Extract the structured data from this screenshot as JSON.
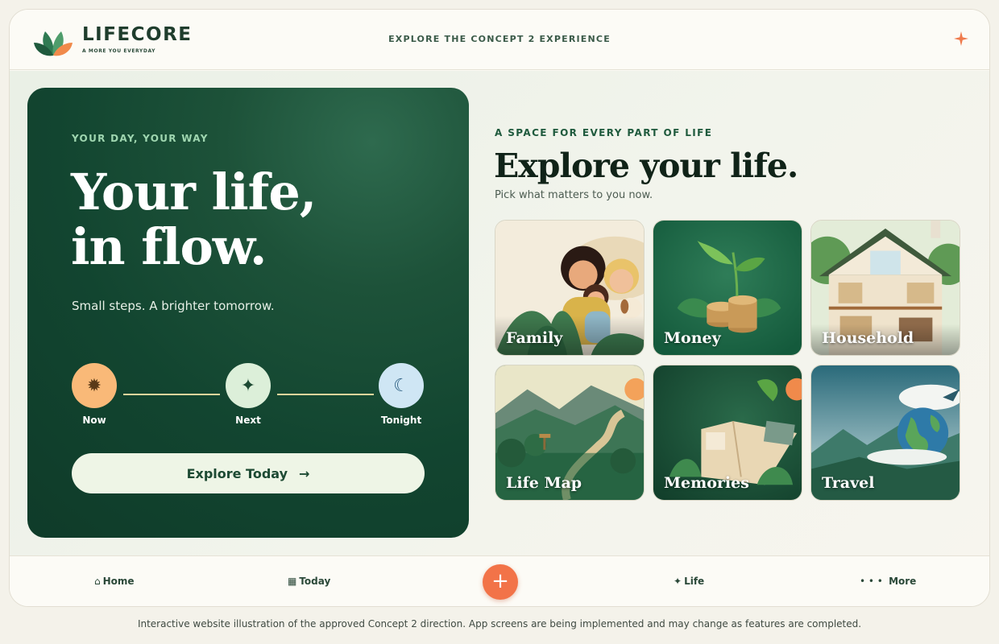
{
  "header": {
    "brand_name": "LIFECORE",
    "brand_tagline": "A MORE YOU EVERYDAY",
    "center_link": "EXPLORE THE CONCEPT 2 EXPERIENCE",
    "sparkle_icon": "sparkle-icon"
  },
  "hero": {
    "eyebrow": "YOUR DAY, YOUR WAY",
    "title_line1": "Your life,",
    "title_line2": "in flow.",
    "subtitle": "Small steps. A brighter tomorrow.",
    "steps": [
      {
        "label": "Now",
        "icon": "sun-icon",
        "glyph": "✹",
        "color": "#f9b978"
      },
      {
        "label": "Next",
        "icon": "sparkle-icon",
        "glyph": "✦",
        "color": "#dcefd9"
      },
      {
        "label": "Tonight",
        "icon": "moon-icon",
        "glyph": "☾",
        "color": "#cfe6f4"
      }
    ],
    "cta_label": "Explore Today",
    "cta_arrow": "→"
  },
  "explore": {
    "eyebrow": "A SPACE FOR EVERY PART OF LIFE",
    "title": "Explore your life.",
    "subtitle": "Pick what matters to you now.",
    "tiles": [
      {
        "label": "Family"
      },
      {
        "label": "Money"
      },
      {
        "label": "Household"
      },
      {
        "label": "Life Map"
      },
      {
        "label": "Memories"
      },
      {
        "label": "Travel"
      }
    ]
  },
  "bottom_nav": {
    "items": [
      {
        "label": "Home",
        "glyph": "⌂",
        "icon": "home-icon"
      },
      {
        "label": "Today",
        "glyph": "▦",
        "icon": "calendar-icon"
      },
      {
        "label": "Life",
        "glyph": "✦",
        "icon": "sparkle-icon"
      },
      {
        "label": "More",
        "glyph": "• • •",
        "icon": "more-icon"
      }
    ],
    "fab_glyph": "+"
  },
  "footer_note": "Interactive website illustration of the approved Concept 2 direction. App screens are being implemented and may change as features are completed.",
  "colors": {
    "accent": "#f27348",
    "hero_bg": "#124530",
    "brand_green": "#1f3d2d"
  }
}
